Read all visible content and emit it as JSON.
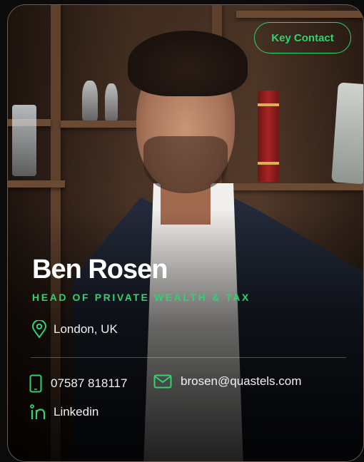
{
  "badge": {
    "label": "Key Contact"
  },
  "person": {
    "name": "Ben Rosen",
    "role": "HEAD OF PRIVATE WEALTH & TAX",
    "location": "London, UK"
  },
  "contacts": {
    "phone": "07587 818117",
    "email": "brosen@quastels.com",
    "linkedin": "Linkedin"
  },
  "icons": {
    "location": "map-pin-icon",
    "phone": "phone-icon",
    "email": "mail-icon",
    "linkedin": "linkedin-icon"
  },
  "colors": {
    "accent": "#2fd36f",
    "text": "#ffffff",
    "card_border": "#5a5a5a"
  }
}
